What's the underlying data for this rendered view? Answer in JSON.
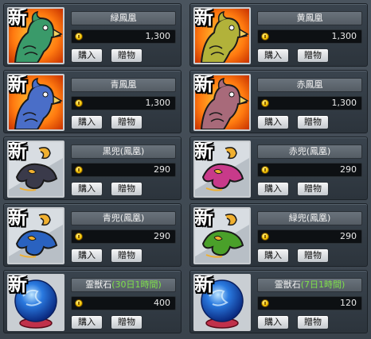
{
  "new_label": "新",
  "buy_label": "購入",
  "gift_label": "贈物",
  "items": [
    {
      "name": "緑鳳凰",
      "name_suffix": "",
      "price": "1,300",
      "icon": "green-phoenix-icon",
      "color": "#3a9a6a"
    },
    {
      "name": "黄鳳凰",
      "name_suffix": "",
      "price": "1,300",
      "icon": "yellow-phoenix-icon",
      "color": "#b2b23a"
    },
    {
      "name": "青鳳凰",
      "name_suffix": "",
      "price": "1,300",
      "icon": "blue-phoenix-icon",
      "color": "#4a6ec8"
    },
    {
      "name": "赤鳳凰",
      "name_suffix": "",
      "price": "1,300",
      "icon": "red-phoenix-icon",
      "color": "#a86a7a"
    },
    {
      "name": "黒兜(鳳凰)",
      "name_suffix": "",
      "price": "290",
      "icon": "black-helmet-icon",
      "color": "#3a3a4a"
    },
    {
      "name": "赤兜(鳳凰)",
      "name_suffix": "",
      "price": "290",
      "icon": "red-helmet-icon",
      "color": "#c83a8a"
    },
    {
      "name": "青兜(鳳凰)",
      "name_suffix": "",
      "price": "290",
      "icon": "blue-helmet-icon",
      "color": "#2a62c0"
    },
    {
      "name": "緑兜(鳳凰)",
      "name_suffix": "",
      "price": "290",
      "icon": "green-helmet-icon",
      "color": "#4aa02a"
    },
    {
      "name": "霊獣石",
      "name_suffix": "(30日1時間)",
      "price": "400",
      "icon": "spirit-orb-icon",
      "color": "#2a7ae0"
    },
    {
      "name": "霊獣石",
      "name_suffix": "(7日1時間)",
      "price": "120",
      "icon": "spirit-orb-icon",
      "color": "#2a7ae0"
    }
  ]
}
